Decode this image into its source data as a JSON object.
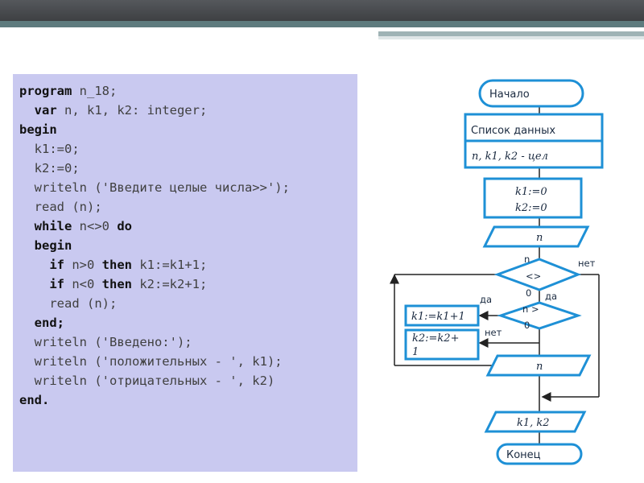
{
  "code": {
    "lines": [
      {
        "indent": "",
        "parts": [
          {
            "t": "program",
            "kw": true
          },
          {
            "t": " n_18;",
            "kw": false
          }
        ]
      },
      {
        "indent": "  ",
        "parts": [
          {
            "t": "var",
            "kw": true
          },
          {
            "t": " n, k1, k2: integer;",
            "kw": false
          }
        ]
      },
      {
        "indent": "",
        "parts": [
          {
            "t": "begin",
            "kw": true
          }
        ]
      },
      {
        "indent": "  ",
        "parts": [
          {
            "t": "k1:=0;",
            "kw": false
          }
        ]
      },
      {
        "indent": "  ",
        "parts": [
          {
            "t": "k2:=0;",
            "kw": false
          }
        ]
      },
      {
        "indent": "  ",
        "parts": [
          {
            "t": "writeln ('Введите целые числа>>');",
            "kw": false
          }
        ]
      },
      {
        "indent": "  ",
        "parts": [
          {
            "t": "read (n);",
            "kw": false
          }
        ]
      },
      {
        "indent": "  ",
        "parts": [
          {
            "t": "while",
            "kw": true
          },
          {
            "t": " n<>0 ",
            "kw": false
          },
          {
            "t": "do",
            "kw": true
          }
        ]
      },
      {
        "indent": "  ",
        "parts": [
          {
            "t": "begin",
            "kw": true
          }
        ]
      },
      {
        "indent": "    ",
        "parts": [
          {
            "t": "if",
            "kw": true
          },
          {
            "t": " n>0 ",
            "kw": false
          },
          {
            "t": "then",
            "kw": true
          },
          {
            "t": " k1:=k1+1;",
            "kw": false
          }
        ]
      },
      {
        "indent": "    ",
        "parts": [
          {
            "t": "if",
            "kw": true
          },
          {
            "t": " n<0 ",
            "kw": false
          },
          {
            "t": "then",
            "kw": true
          },
          {
            "t": " k2:=k2+1;",
            "kw": false
          }
        ]
      },
      {
        "indent": "    ",
        "parts": [
          {
            "t": "read (n);",
            "kw": false
          }
        ]
      },
      {
        "indent": "  ",
        "parts": [
          {
            "t": "end;",
            "kw": true
          }
        ]
      },
      {
        "indent": "  ",
        "parts": [
          {
            "t": "writeln ('Введено:');",
            "kw": false
          }
        ]
      },
      {
        "indent": "  ",
        "parts": [
          {
            "t": "writeln ('положительных - ', k1);",
            "kw": false
          }
        ]
      },
      {
        "indent": "  ",
        "parts": [
          {
            "t": "writeln ('отрицательных - ', k2)",
            "kw": false
          }
        ]
      },
      {
        "indent": "",
        "parts": [
          {
            "t": "end.",
            "kw": true
          }
        ]
      }
    ]
  },
  "flowchart": {
    "start": "Начало",
    "data_header": "Список данных",
    "data_vars": "n, k1, k2 - цел",
    "init1": "k1:=0",
    "init2": "k2:=0",
    "input_n": "n",
    "cond1_top": "n",
    "cond1_mid": "<>",
    "cond1_bot": "0",
    "cond1_no": "нет",
    "cond1_yes": "да",
    "cond2_top": "n >",
    "cond2_bot": "0",
    "cond2_yes": "да",
    "cond2_no": "нет",
    "inc1": "k1:=k1+1",
    "inc2_line1": "k2:=k2+",
    "inc2_line2": "1",
    "input_n2": "n",
    "output": "k1, k2",
    "end": "Конец"
  },
  "colors": {
    "accent": "#1e90d6",
    "code_bg": "#c9c9f0",
    "line": "#222222"
  }
}
